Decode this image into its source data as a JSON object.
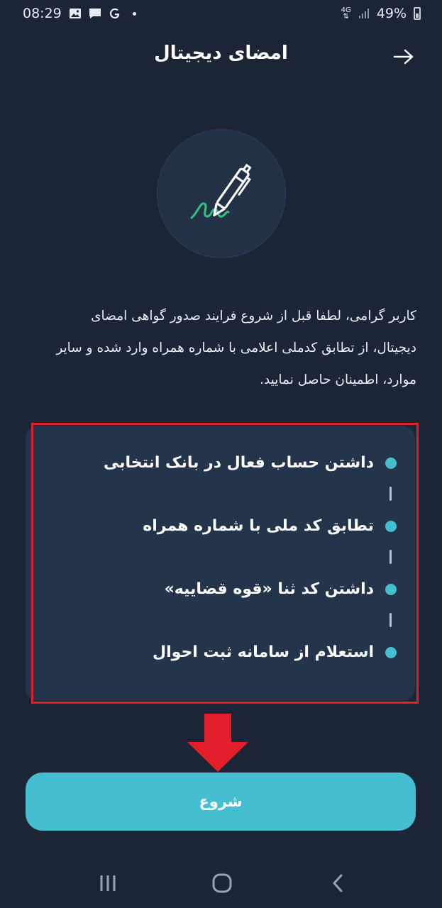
{
  "status_bar": {
    "time": "08:29",
    "network": "4G",
    "battery": "49%",
    "notification_icons": [
      "image-icon",
      "message-icon",
      "google-icon",
      "dot-icon"
    ]
  },
  "header": {
    "title": "امضای دیجیتال",
    "back_icon": "arrow-right-icon"
  },
  "hero": {
    "icon": "pen-signature-icon",
    "accent_color": "#35c07a"
  },
  "intro": {
    "line1": "کاربر گرامی، لطفا قبل از شروع فرایند صدور گواهی امضای",
    "line2": "دیجیتال، از تطابق کدملی اعلامی با شماره همراه وارد شده و سایر",
    "line3": "موارد، اطمینان حاصل نمایید."
  },
  "requirements": [
    {
      "label": "داشتن حساب فعال در بانک انتخابی"
    },
    {
      "label": "تطابق کد ملی با شماره همراه"
    },
    {
      "label": "داشتن کد ثنا «قوه قضاییه»"
    },
    {
      "label": "استعلام از سامانه ثبت احوال"
    }
  ],
  "start_button": {
    "label": "شروع"
  },
  "colors": {
    "background": "#1b2536",
    "card": "#24344b",
    "accent": "#45bfd0",
    "highlight": "#e31e2b"
  },
  "nav_bar": {
    "recent_icon": "recent-apps-icon",
    "home_icon": "home-icon",
    "back_icon": "back-chevron-icon"
  }
}
